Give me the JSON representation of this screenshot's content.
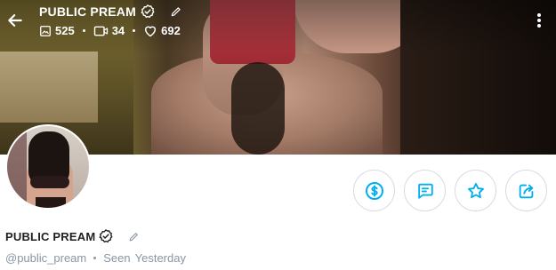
{
  "profile": {
    "name": "PUBLIC PREAM",
    "username": "@public_pream",
    "seen_label": "Seen",
    "seen_value": "Yesterday"
  },
  "stats": {
    "photos": "525",
    "videos": "34",
    "likes": "692"
  },
  "colors": {
    "accent": "#00aff0",
    "muted": "#8a96a3",
    "border": "#d7dbe3"
  },
  "icons": {
    "back": "arrow-left-icon",
    "verified": "verified-badge-icon",
    "edit": "pencil-icon",
    "photos": "image-icon",
    "videos": "video-icon",
    "likes": "heart-icon",
    "more": "more-vertical-icon",
    "tip": "dollar-circle-icon",
    "message": "message-icon",
    "favorite": "star-icon",
    "share": "share-icon"
  }
}
